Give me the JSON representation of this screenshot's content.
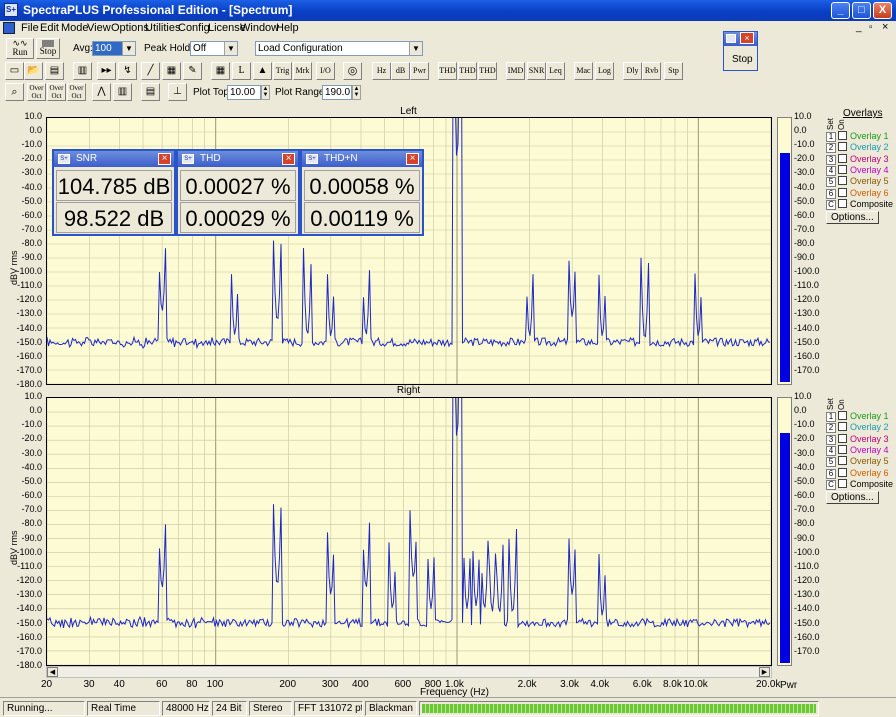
{
  "window": {
    "title": "SpectraPLUS Professional Edition - [Spectrum]",
    "min": "_",
    "max": "□",
    "close": "X"
  },
  "menu": [
    "File",
    "Edit",
    "Mode",
    "View",
    "Options",
    "Utilities",
    "Config",
    "License",
    "Window",
    "Help"
  ],
  "toolbar1": {
    "run_label": "Run",
    "stop_label": "Stop",
    "avg_label": "Avg:",
    "avg_value": "100",
    "peak_hold_label": "Peak Hold:",
    "peak_hold_value": "Off",
    "load_config": "Load Configuration"
  },
  "floating_stop": {
    "title": "",
    "button": "Stop"
  },
  "toolbar2": [
    "Trig",
    "Mrk",
    "I/O",
    "Hz",
    "dB",
    "Pwr",
    "THD",
    "THD +N",
    "THD Freq",
    "IMD",
    "SNR",
    "Leq",
    "Mac",
    "Log",
    "Dly",
    "Rvb",
    "Stp"
  ],
  "toolbar3": {
    "plot_top_label": "Plot Top:",
    "plot_top_value": "10.00",
    "plot_range_label": "Plot Range:",
    "plot_range_value": "190.0",
    "zoom_labels": [
      "Over Oct",
      "Over Oct",
      "Over Oct"
    ]
  },
  "panels": {
    "left": {
      "title": "Left"
    },
    "right": {
      "title": "Right"
    },
    "y_axis_label": "dBV rms",
    "x_axis_label": "Frequency (Hz)",
    "pwr_label": "Pwr",
    "x_ticks": [
      "20",
      "30",
      "40",
      "60",
      "80",
      "100",
      "200",
      "300",
      "400",
      "600",
      "800",
      "1.0k",
      "2.0k",
      "3.0k",
      "4.0k",
      "6.0k",
      "8.0k",
      "10.0k",
      "20.0k"
    ],
    "y_ticks": [
      "10.0",
      "0.0",
      "-10.0",
      "-20.0",
      "-30.0",
      "-40.0",
      "-50.0",
      "-60.0",
      "-70.0",
      "-80.0",
      "-90.0",
      "-100.0",
      "-110.0",
      "-120.0",
      "-130.0",
      "-140.0",
      "-150.0",
      "-160.0",
      "-170.0",
      "-180.0"
    ],
    "meter_ticks": [
      "10.0",
      "0.0",
      "-10.0",
      "-20.0",
      "-30.0",
      "-40.0",
      "-50.0",
      "-60.0",
      "-70.0",
      "-80.0",
      "-90.0",
      "-100.0",
      "-110.0",
      "-120.0",
      "-130.0",
      "-140.0",
      "-150.0",
      "-160.0",
      "-170.0"
    ],
    "left_meter_level_db": -15,
    "right_meter_level_db": -15
  },
  "overlays": {
    "title": "Overlays",
    "col_set": "Set",
    "col_on": "On",
    "items": [
      {
        "num": "1",
        "label": "Overlay 1",
        "color": "#1a9a1a"
      },
      {
        "num": "2",
        "label": "Overlay 2",
        "color": "#1a9aaa"
      },
      {
        "num": "3",
        "label": "Overlay 3",
        "color": "#c0007a"
      },
      {
        "num": "4",
        "label": "Overlay 4",
        "color": "#c000c0"
      },
      {
        "num": "5",
        "label": "Overlay 5",
        "color": "#8a5a00"
      },
      {
        "num": "6",
        "label": "Overlay 6",
        "color": "#d06000"
      },
      {
        "num": "C",
        "label": "Composite",
        "color": "#000000"
      }
    ],
    "options_label": "Options..."
  },
  "meters": [
    {
      "title": "SNR",
      "v1": "104.785 dB",
      "v2": "98.522 dB"
    },
    {
      "title": "THD",
      "v1": "0.00027 %",
      "v2": "0.00029 %"
    },
    {
      "title": "THD+N",
      "v1": "0.00058 %",
      "v2": "0.00119 %"
    }
  ],
  "status": [
    "Running...",
    "Real Time",
    "48000 Hz",
    "24 Bit",
    "Stereo",
    "FFT 131072 pts",
    "Blackman"
  ],
  "colors": {
    "trace": "#1e28c8",
    "plot_bg": "#fdfbd3",
    "grid": "#c8c6a0",
    "meter_bar": "#0000e0"
  },
  "spectrum": {
    "left_peaks": [
      [
        60,
        -128
      ],
      [
        120,
        -145
      ],
      [
        180,
        -135
      ],
      [
        240,
        -145
      ],
      [
        300,
        -146
      ],
      [
        420,
        -145
      ],
      [
        1000,
        -20
      ],
      [
        2000,
        -146
      ],
      [
        3000,
        -132
      ],
      [
        4000,
        -146
      ],
      [
        6000,
        -148
      ],
      [
        10000,
        -146
      ]
    ],
    "right_peaks": [
      [
        60,
        -125
      ],
      [
        180,
        -123
      ],
      [
        300,
        -130
      ],
      [
        420,
        -125
      ],
      [
        540,
        -140
      ],
      [
        660,
        -118
      ],
      [
        780,
        -140
      ],
      [
        1000,
        -20
      ],
      [
        1100,
        -140
      ],
      [
        1200,
        -138
      ],
      [
        1300,
        -140
      ],
      [
        1400,
        -142
      ],
      [
        1500,
        -143
      ],
      [
        1700,
        -143
      ],
      [
        3000,
        -130
      ],
      [
        4000,
        -145
      ]
    ],
    "noise_floor_db": -150
  }
}
